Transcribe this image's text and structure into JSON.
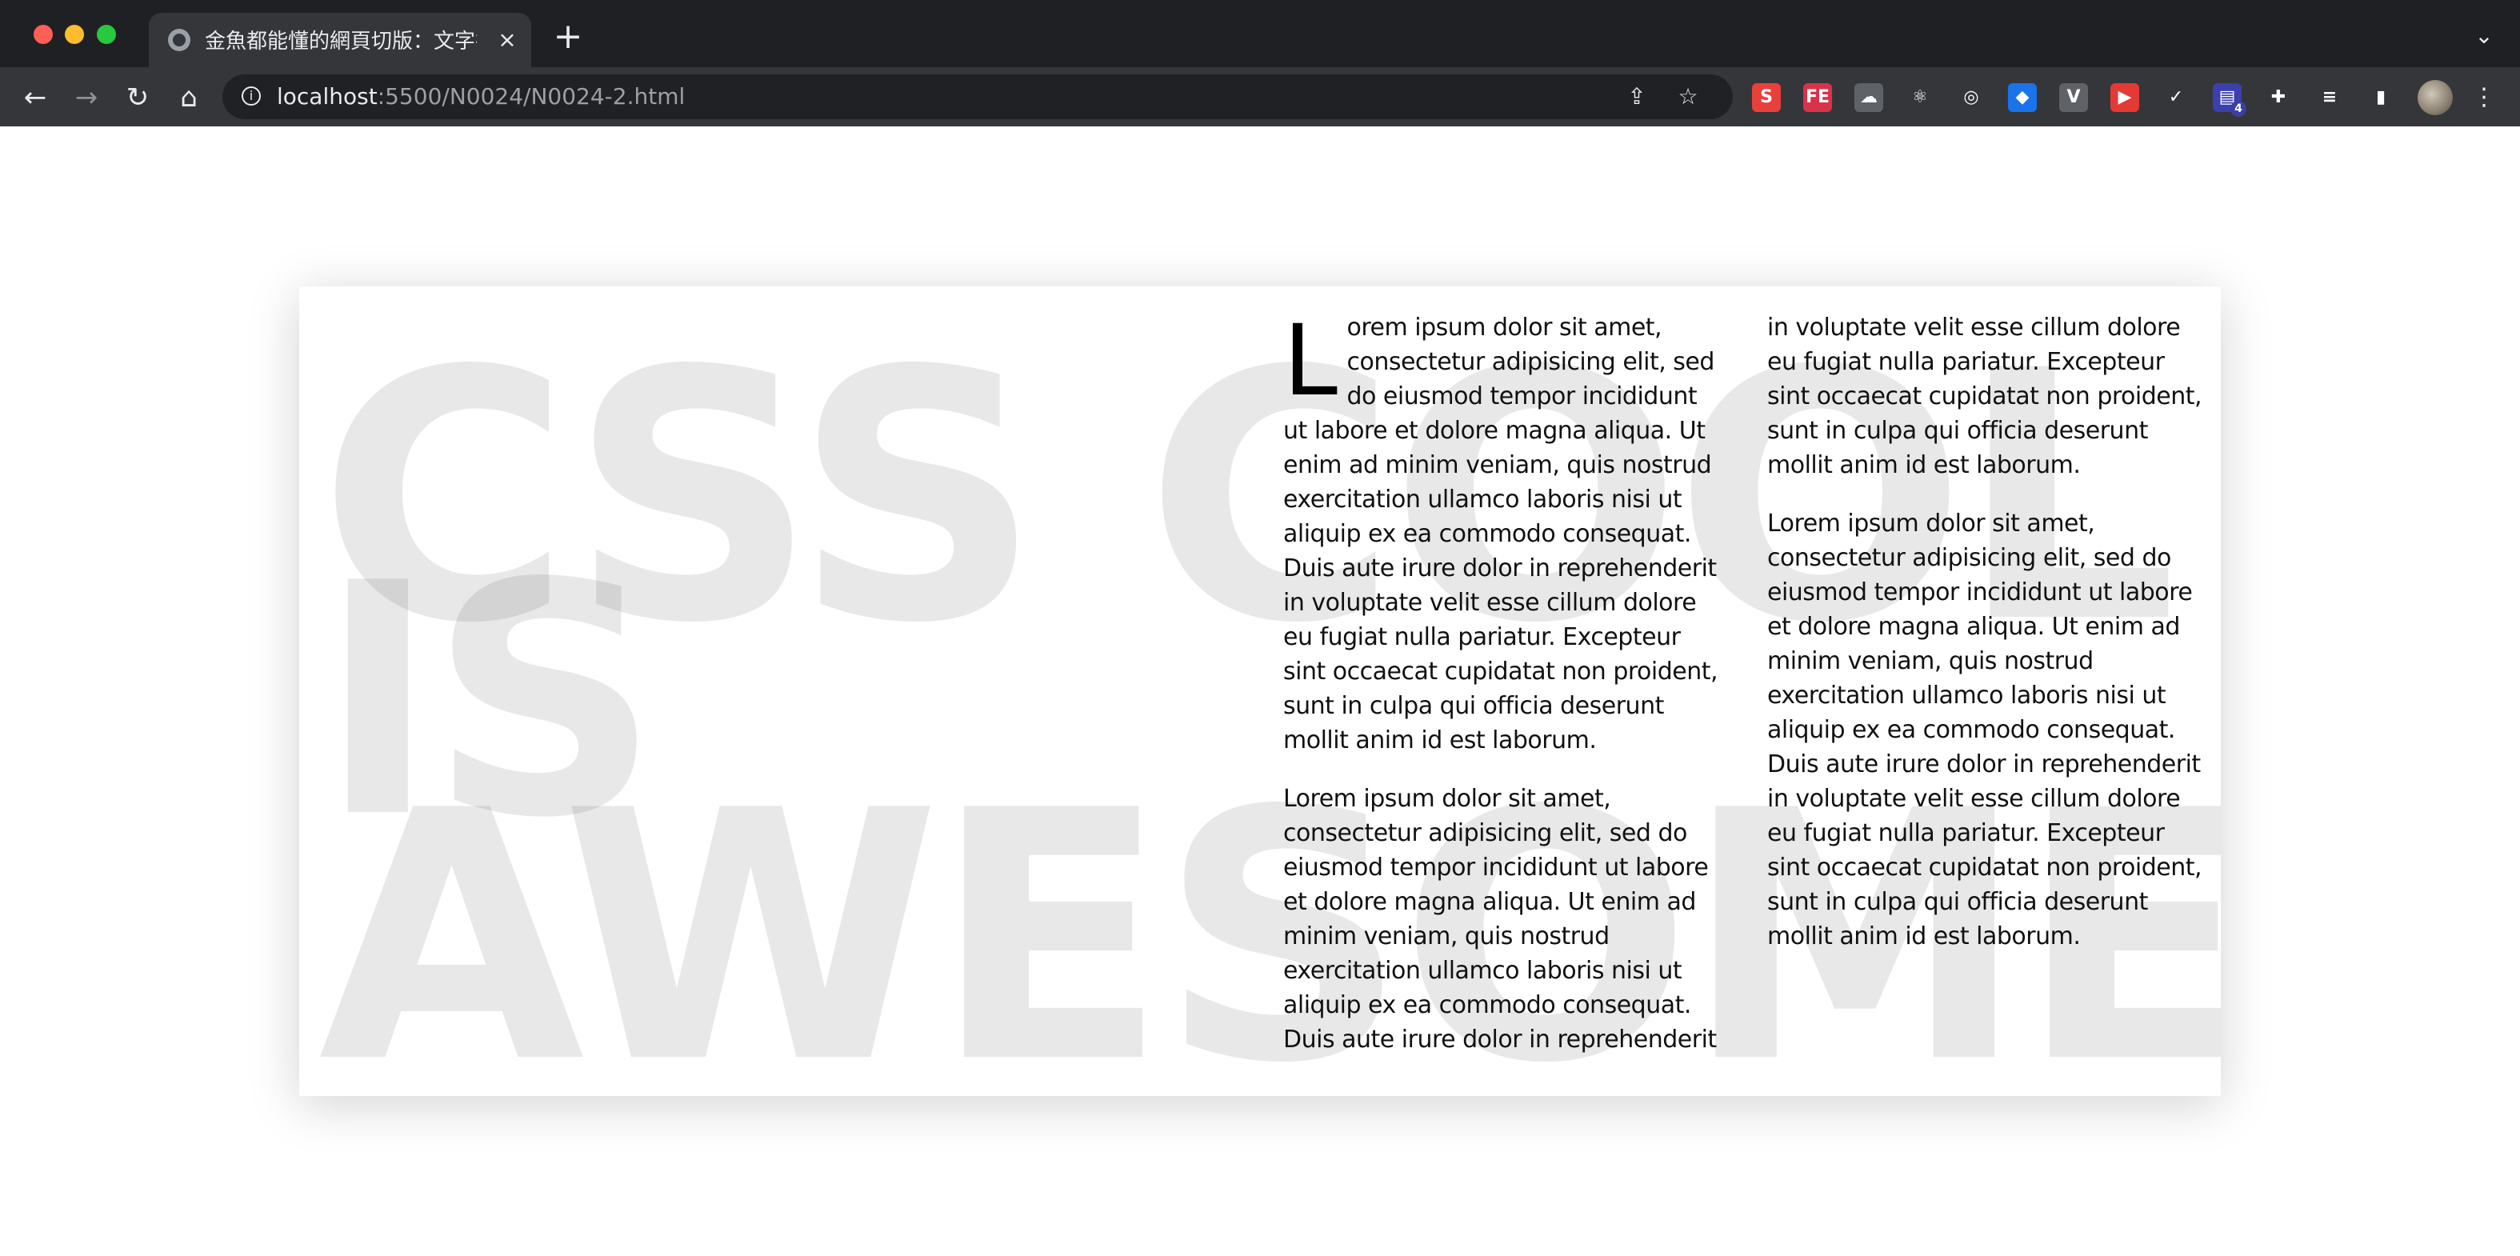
{
  "browser": {
    "tab_title": "金魚都能懂的網頁切版：文字排版",
    "tab_close_icon": "×",
    "new_tab_icon": "+",
    "tab_menu_icon": "⌄",
    "url_host": "localhost",
    "url_path": ":5500/N0024/N0024-2.html",
    "extensions": [
      {
        "name": "s-extension-icon",
        "label": "S",
        "color": "#e8413b"
      },
      {
        "name": "fe-extension-icon",
        "label": "FE",
        "color": "#d8334a"
      },
      {
        "name": "cloud-extension-icon",
        "label": "☁",
        "color": "#5f6368"
      },
      {
        "name": "react-extension-icon",
        "label": "⚛",
        "color": "#35363a"
      },
      {
        "name": "target-extension-icon",
        "label": "◎",
        "color": "#35363a"
      },
      {
        "name": "gem-extension-icon",
        "label": "◆",
        "color": "#1a73e8"
      },
      {
        "name": "vue-extension-icon",
        "label": "V",
        "color": "#5f6368"
      },
      {
        "name": "play-extension-icon",
        "label": "▶",
        "color": "#e53935"
      },
      {
        "name": "check-extension-icon",
        "label": "✓",
        "color": "#35363a"
      },
      {
        "name": "stack-extension-icon",
        "label": "▤",
        "color": "#3c3fae",
        "badge": "4"
      },
      {
        "name": "puzzle-extension-icon",
        "label": "✚",
        "color": "#35363a"
      },
      {
        "name": "reading-list-icon",
        "label": "≡",
        "color": "#35363a"
      },
      {
        "name": "side-panel-icon",
        "label": "▮",
        "color": "#35363a"
      }
    ]
  },
  "article": {
    "background_text": {
      "line1": "CSS COOL",
      "line2": "IS",
      "line3": "AWESOME"
    },
    "drop_cap": "L",
    "paragraph1_rest": "orem ipsum dolor sit amet, consectetur adipisicing elit, sed do eiusmod tempor incididunt ut labore et dolore magna aliqua. Ut enim ad minim veniam, quis nostrud exercitation ullamco laboris nisi ut aliquip ex ea commodo consequat. Duis aute irure dolor in reprehenderit in voluptate velit esse cillum dolore eu fugiat nulla pariatur. Excepteur sint occaecat cupidatat non proident, sunt in culpa qui officia deserunt mollit anim id est laborum.",
    "paragraph2": "Lorem ipsum dolor sit amet, consectetur adipisicing elit, sed do eiusmod tempor incididunt ut labore et dolore magna aliqua. Ut enim ad minim veniam, quis nostrud exercitation ullamco laboris nisi ut aliquip ex ea commodo consequat. Duis aute irure dolor in reprehenderit in voluptate velit esse cillum dolore eu fugiat nulla pariatur. Excepteur sint occaecat cupidatat non proident, sunt in culpa qui officia deserunt mollit anim id est laborum.",
    "paragraph3": "Lorem ipsum dolor sit amet, consectetur adipisicing elit, sed do eiusmod tempor incididunt ut labore et dolore magna aliqua. Ut enim ad minim veniam, quis nostrud exercitation ullamco laboris nisi ut aliquip ex ea commodo consequat. Duis aute irure dolor in reprehenderit in voluptate velit esse cillum dolore eu fugiat nulla pariatur. Excepteur sint occaecat cupidatat non proident, sunt in culpa qui officia deserunt mollit anim id est laborum."
  }
}
